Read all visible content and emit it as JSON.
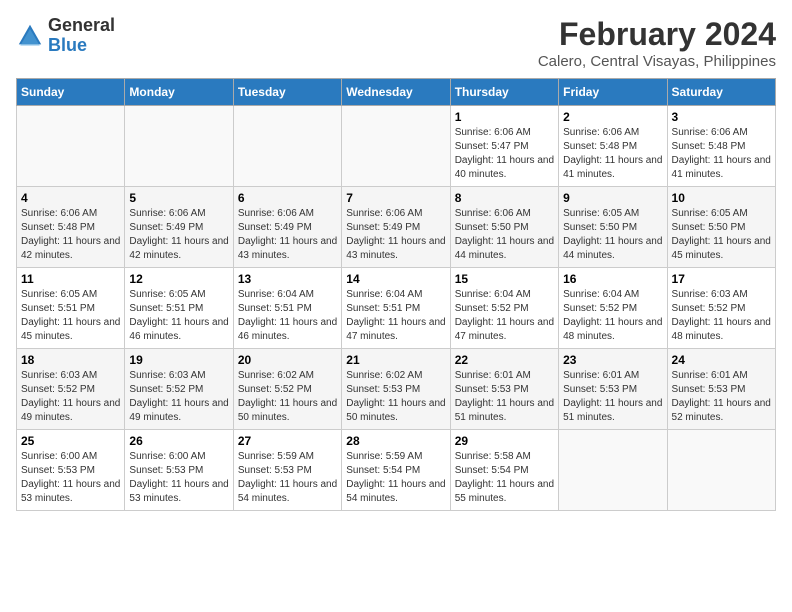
{
  "header": {
    "logo_general": "General",
    "logo_blue": "Blue",
    "title": "February 2024",
    "subtitle": "Calero, Central Visayas, Philippines"
  },
  "columns": [
    "Sunday",
    "Monday",
    "Tuesday",
    "Wednesday",
    "Thursday",
    "Friday",
    "Saturday"
  ],
  "weeks": [
    [
      {
        "day": "",
        "info": ""
      },
      {
        "day": "",
        "info": ""
      },
      {
        "day": "",
        "info": ""
      },
      {
        "day": "",
        "info": ""
      },
      {
        "day": "1",
        "info": "Sunrise: 6:06 AM\nSunset: 5:47 PM\nDaylight: 11 hours and 40 minutes."
      },
      {
        "day": "2",
        "info": "Sunrise: 6:06 AM\nSunset: 5:48 PM\nDaylight: 11 hours and 41 minutes."
      },
      {
        "day": "3",
        "info": "Sunrise: 6:06 AM\nSunset: 5:48 PM\nDaylight: 11 hours and 41 minutes."
      }
    ],
    [
      {
        "day": "4",
        "info": "Sunrise: 6:06 AM\nSunset: 5:48 PM\nDaylight: 11 hours and 42 minutes."
      },
      {
        "day": "5",
        "info": "Sunrise: 6:06 AM\nSunset: 5:49 PM\nDaylight: 11 hours and 42 minutes."
      },
      {
        "day": "6",
        "info": "Sunrise: 6:06 AM\nSunset: 5:49 PM\nDaylight: 11 hours and 43 minutes."
      },
      {
        "day": "7",
        "info": "Sunrise: 6:06 AM\nSunset: 5:49 PM\nDaylight: 11 hours and 43 minutes."
      },
      {
        "day": "8",
        "info": "Sunrise: 6:06 AM\nSunset: 5:50 PM\nDaylight: 11 hours and 44 minutes."
      },
      {
        "day": "9",
        "info": "Sunrise: 6:05 AM\nSunset: 5:50 PM\nDaylight: 11 hours and 44 minutes."
      },
      {
        "day": "10",
        "info": "Sunrise: 6:05 AM\nSunset: 5:50 PM\nDaylight: 11 hours and 45 minutes."
      }
    ],
    [
      {
        "day": "11",
        "info": "Sunrise: 6:05 AM\nSunset: 5:51 PM\nDaylight: 11 hours and 45 minutes."
      },
      {
        "day": "12",
        "info": "Sunrise: 6:05 AM\nSunset: 5:51 PM\nDaylight: 11 hours and 46 minutes."
      },
      {
        "day": "13",
        "info": "Sunrise: 6:04 AM\nSunset: 5:51 PM\nDaylight: 11 hours and 46 minutes."
      },
      {
        "day": "14",
        "info": "Sunrise: 6:04 AM\nSunset: 5:51 PM\nDaylight: 11 hours and 47 minutes."
      },
      {
        "day": "15",
        "info": "Sunrise: 6:04 AM\nSunset: 5:52 PM\nDaylight: 11 hours and 47 minutes."
      },
      {
        "day": "16",
        "info": "Sunrise: 6:04 AM\nSunset: 5:52 PM\nDaylight: 11 hours and 48 minutes."
      },
      {
        "day": "17",
        "info": "Sunrise: 6:03 AM\nSunset: 5:52 PM\nDaylight: 11 hours and 48 minutes."
      }
    ],
    [
      {
        "day": "18",
        "info": "Sunrise: 6:03 AM\nSunset: 5:52 PM\nDaylight: 11 hours and 49 minutes."
      },
      {
        "day": "19",
        "info": "Sunrise: 6:03 AM\nSunset: 5:52 PM\nDaylight: 11 hours and 49 minutes."
      },
      {
        "day": "20",
        "info": "Sunrise: 6:02 AM\nSunset: 5:52 PM\nDaylight: 11 hours and 50 minutes."
      },
      {
        "day": "21",
        "info": "Sunrise: 6:02 AM\nSunset: 5:53 PM\nDaylight: 11 hours and 50 minutes."
      },
      {
        "day": "22",
        "info": "Sunrise: 6:01 AM\nSunset: 5:53 PM\nDaylight: 11 hours and 51 minutes."
      },
      {
        "day": "23",
        "info": "Sunrise: 6:01 AM\nSunset: 5:53 PM\nDaylight: 11 hours and 51 minutes."
      },
      {
        "day": "24",
        "info": "Sunrise: 6:01 AM\nSunset: 5:53 PM\nDaylight: 11 hours and 52 minutes."
      }
    ],
    [
      {
        "day": "25",
        "info": "Sunrise: 6:00 AM\nSunset: 5:53 PM\nDaylight: 11 hours and 53 minutes."
      },
      {
        "day": "26",
        "info": "Sunrise: 6:00 AM\nSunset: 5:53 PM\nDaylight: 11 hours and 53 minutes."
      },
      {
        "day": "27",
        "info": "Sunrise: 5:59 AM\nSunset: 5:53 PM\nDaylight: 11 hours and 54 minutes."
      },
      {
        "day": "28",
        "info": "Sunrise: 5:59 AM\nSunset: 5:54 PM\nDaylight: 11 hours and 54 minutes."
      },
      {
        "day": "29",
        "info": "Sunrise: 5:58 AM\nSunset: 5:54 PM\nDaylight: 11 hours and 55 minutes."
      },
      {
        "day": "",
        "info": ""
      },
      {
        "day": "",
        "info": ""
      }
    ]
  ]
}
